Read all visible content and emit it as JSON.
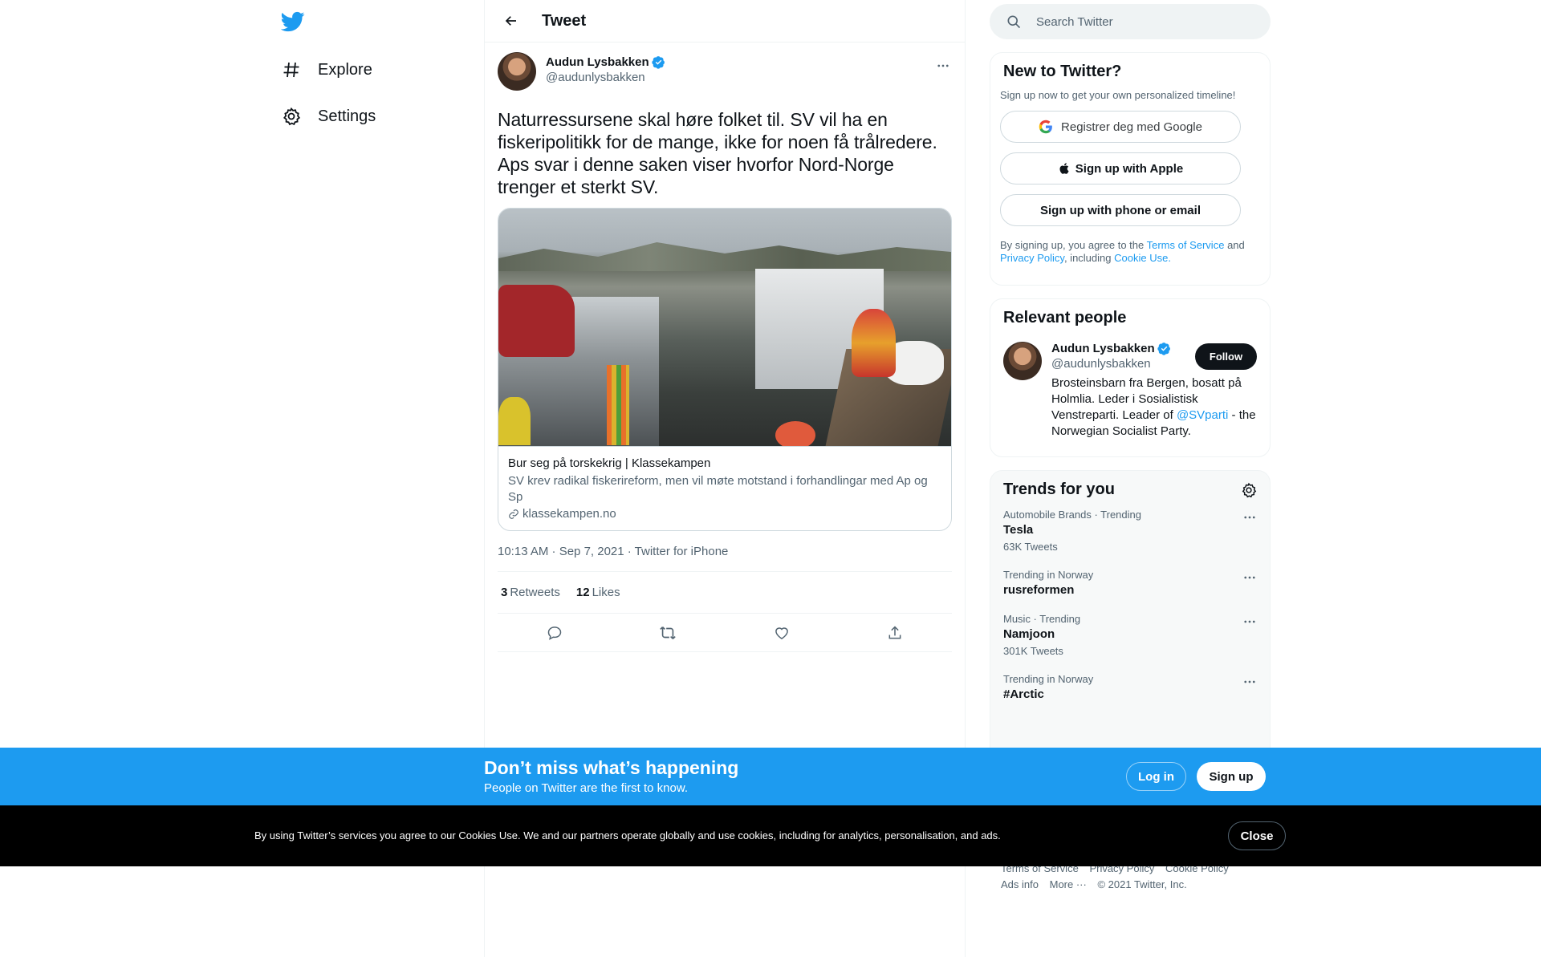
{
  "nav": {
    "explore": "Explore",
    "settings": "Settings"
  },
  "header": {
    "title": "Tweet"
  },
  "tweet": {
    "author_name": "Audun Lysbakken",
    "author_handle": "@audunlysbakken",
    "text": "Naturressursene skal høre folket til. SV vil ha en fiskeripolitikk for de mange, ikke for noen få trålredere. Aps svar i denne saken viser hvorfor Nord-Norge trenger et sterkt SV.",
    "card": {
      "title": "Bur seg på torskekrig | Klassekampen",
      "description": "SV krev radikal fiskerireform, men vil møte motstand i forhandlingar med Ap og Sp",
      "domain": "klassekampen.no"
    },
    "meta": "10:13 AM · Sep 7, 2021 · Twitter for iPhone",
    "retweets_count": "3",
    "retweets_label": "Retweets",
    "likes_count": "12",
    "likes_label": "Likes"
  },
  "search": {
    "placeholder": "Search Twitter"
  },
  "new_to_twitter": {
    "title": "New to Twitter?",
    "subtitle": "Sign up now to get your own personalized timeline!",
    "google": "Registrer deg med Google",
    "apple": "Sign up with Apple",
    "phone": "Sign up with phone or email",
    "terms_prefix": "By signing up, you agree to the",
    "terms_link": "Terms of Service",
    "terms_and": "and",
    "privacy_link": "Privacy Policy",
    "including": ", including",
    "cookie_link": "Cookie Use."
  },
  "relevant": {
    "title": "Relevant people",
    "name": "Audun Lysbakken",
    "handle": "@audunlysbakken",
    "follow": "Follow",
    "bio_1": "Brosteinsbarn fra Bergen, bosatt på Holmlia. Leder i Sosialistisk Venstreparti. Leader of",
    "bio_link": "@SVparti",
    "bio_2": "- the Norwegian Socialist Party."
  },
  "trends": {
    "title": "Trends for you",
    "items": [
      {
        "category": "Automobile Brands · Trending",
        "title": "Tesla",
        "count": "63K Tweets"
      },
      {
        "category": "Trending in Norway",
        "title": "rusreformen",
        "count": ""
      },
      {
        "category": "Music · Trending",
        "title": "Namjoon",
        "count": "301K Tweets"
      },
      {
        "category": "Trending in Norway",
        "title": "#Arctic",
        "count": ""
      }
    ]
  },
  "footer": {
    "terms": "Terms of Service",
    "privacy": "Privacy Policy",
    "cookie": "Cookie Policy",
    "ads": "Ads info",
    "more": "More ···",
    "copyright": "© 2021 Twitter, Inc."
  },
  "promo": {
    "title": "Don’t miss what’s happening",
    "subtitle": "People on Twitter are the first to know.",
    "login": "Log in",
    "signup": "Sign up"
  },
  "cookie_bar": {
    "text": "By using Twitter’s services you agree to our Cookies Use. We and our partners operate globally and use cookies, including for analytics, personalisation, and ads.",
    "close": "Close"
  },
  "colors": {
    "accent": "#1d9bf0",
    "text": "#0f1419",
    "secondary": "#536471",
    "border": "#eff3f4"
  }
}
